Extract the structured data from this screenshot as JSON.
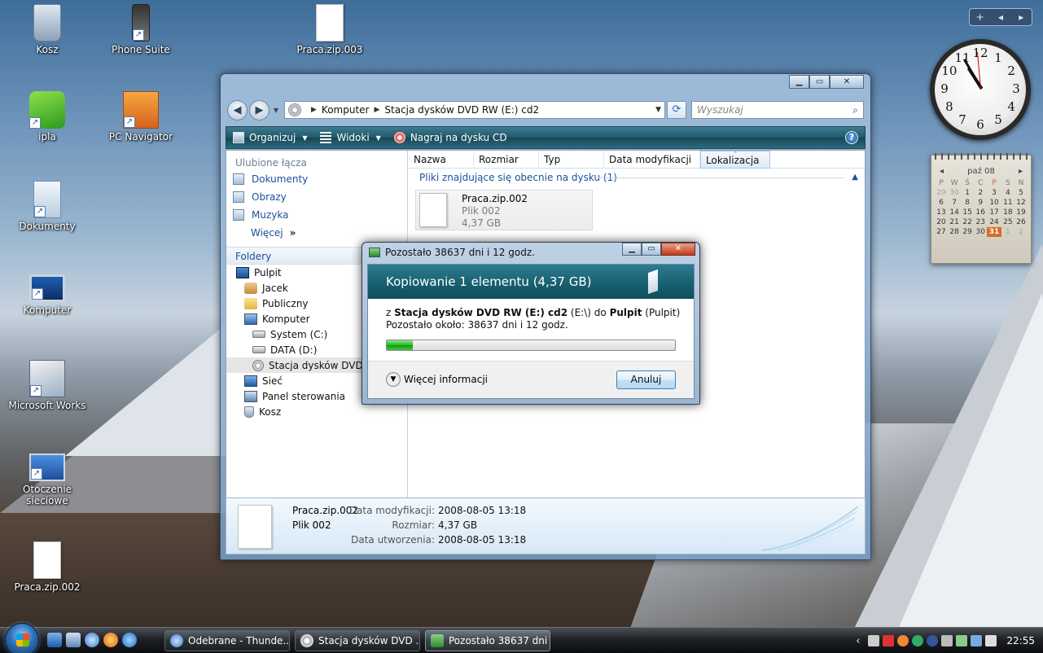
{
  "desktop": {
    "icons": [
      {
        "label": "Kosz"
      },
      {
        "label": "Phone Suite"
      },
      {
        "label": "Praca.zip.003"
      },
      {
        "label": "ipla"
      },
      {
        "label": "PC Navigator"
      },
      {
        "label": "Dokumenty"
      },
      {
        "label": "Komputer"
      },
      {
        "label": "Microsoft Works"
      },
      {
        "label": "Otoczenie sieciowe"
      },
      {
        "label": "Praca.zip.002"
      }
    ]
  },
  "gadgets": {
    "toolbar": {
      "add": "+",
      "prev": "◂",
      "next": "▸"
    },
    "clock": {
      "numbers": [
        "12",
        "1",
        "2",
        "3",
        "4",
        "5",
        "6",
        "7",
        "8",
        "9",
        "10",
        "11"
      ],
      "time": "22:55"
    },
    "calendar": {
      "month": "paź 08",
      "prev": "◂",
      "next": "▸",
      "weekdays": [
        "P",
        "W",
        "Ś",
        "C",
        "P",
        "S",
        "N"
      ],
      "weeks": [
        [
          "29",
          "30",
          "1",
          "2",
          "3",
          "4",
          "5"
        ],
        [
          "6",
          "7",
          "8",
          "9",
          "10",
          "11",
          "12"
        ],
        [
          "13",
          "14",
          "15",
          "16",
          "17",
          "18",
          "19"
        ],
        [
          "20",
          "21",
          "22",
          "23",
          "24",
          "25",
          "26"
        ],
        [
          "27",
          "28",
          "29",
          "30",
          "31",
          "1",
          "2"
        ]
      ],
      "today": "31"
    }
  },
  "explorer": {
    "address": {
      "crumbs": [
        "Komputer",
        "Stacja dysków DVD RW (E:) cd2"
      ]
    },
    "search_placeholder": "Wyszukaj",
    "toolbar": {
      "organize": "Organizuj",
      "views": "Widoki",
      "burn": "Nagraj na dysku CD"
    },
    "nav": {
      "favorites_title": "Ulubione łącza",
      "favorites": [
        "Dokumenty",
        "Obrazy",
        "Muzyka"
      ],
      "more": "Więcej",
      "folders_title": "Foldery",
      "tree": [
        {
          "label": "Pulpit",
          "indent": 0,
          "icon": "desk"
        },
        {
          "label": "Jacek",
          "indent": 1,
          "icon": "user"
        },
        {
          "label": "Publiczny",
          "indent": 1,
          "icon": "folder"
        },
        {
          "label": "Komputer",
          "indent": 1,
          "icon": "comp"
        },
        {
          "label": "System (C:)",
          "indent": 2,
          "icon": "hdd"
        },
        {
          "label": "DATA (D:)",
          "indent": 2,
          "icon": "hdd"
        },
        {
          "label": "Stacja dysków DVD RW (E:) cd2",
          "indent": 2,
          "icon": "dvd",
          "selected": true
        },
        {
          "label": "Sieć",
          "indent": 1,
          "icon": "net"
        },
        {
          "label": "Panel sterowania",
          "indent": 1,
          "icon": "cp"
        },
        {
          "label": "Kosz",
          "indent": 1,
          "icon": "bin"
        }
      ]
    },
    "columns": [
      "Nazwa",
      "Rozmiar",
      "Typ",
      "Data modyfikacji",
      "Lokalizacja"
    ],
    "group_header": "Pliki znajdujące się obecnie na dysku (1)",
    "file": {
      "name": "Praca.zip.002",
      "type": "Plik 002",
      "size": "4,37 GB"
    },
    "details": {
      "name": "Praca.zip.002",
      "type": "Plik 002",
      "rows": [
        {
          "label": "Data modyfikacji:",
          "value": "2008-08-05 13:18"
        },
        {
          "label": "Rozmiar:",
          "value": "4,37 GB"
        },
        {
          "label": "Data utworzenia:",
          "value": "2008-08-05 13:18"
        }
      ]
    }
  },
  "copy_dialog": {
    "title": "Pozostało 38637 dni i 12 godz.",
    "banner": "Kopiowanie 1 elementu (4,37 GB)",
    "from_prefix": "z",
    "from_name": "Stacja dysków DVD RW (E:) cd2",
    "from_path": "(E:\\)",
    "to_word": "do",
    "to_name": "Pulpit",
    "to_path": "(Pulpit)",
    "remaining": "Pozostało około: 38637 dni i 12 godz.",
    "progress_fraction": 0.09,
    "more_info": "Więcej informacji",
    "cancel": "Anuluj"
  },
  "taskbar": {
    "buttons": [
      {
        "label": "Odebrane - Thunde...",
        "active": false
      },
      {
        "label": "Stacja dysków DVD ...",
        "active": false
      },
      {
        "label": "Pozostało 38637 dni ...",
        "active": true
      }
    ],
    "tray_time": "22:55"
  }
}
